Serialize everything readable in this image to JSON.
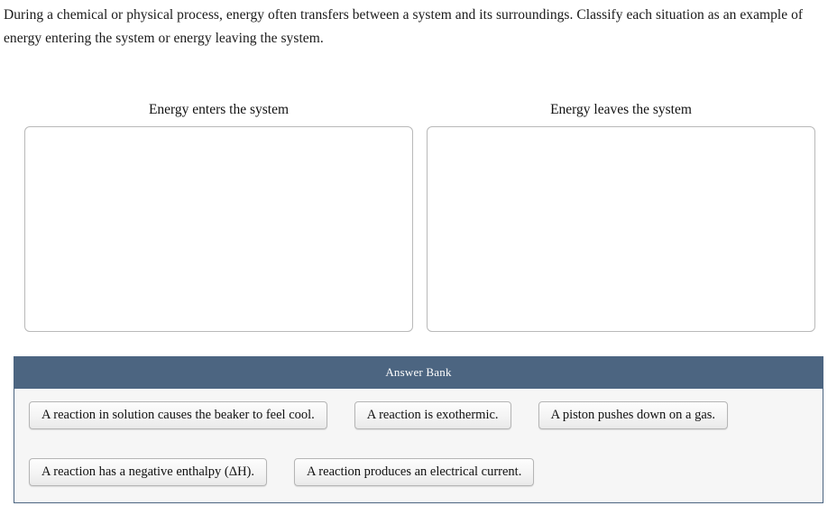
{
  "prompt": {
    "text": "During a chemical or physical process, energy often transfers between a system and its surroundings. Classify each situation as an example of energy entering the system or energy leaving the system."
  },
  "zones": [
    {
      "id": "energy-enters",
      "title": "Energy enters the system",
      "items": []
    },
    {
      "id": "energy-leaves",
      "title": "Energy leaves the system",
      "items": []
    }
  ],
  "answer_bank": {
    "header": "Answer Bank",
    "rows": [
      [
        "A reaction in solution causes the beaker to feel cool.",
        "A reaction is exothermic.",
        "A piston pushes down on a gas."
      ],
      [
        "A reaction has a negative enthalpy (ΔH).",
        "A reaction produces an electrical current."
      ]
    ]
  },
  "colors": {
    "header_bar": "#4c6581",
    "panel_background": "#f6f6f6",
    "zone_border": "#b9b9b9",
    "tile_border": "#b5b5b5",
    "text": "#111111"
  }
}
